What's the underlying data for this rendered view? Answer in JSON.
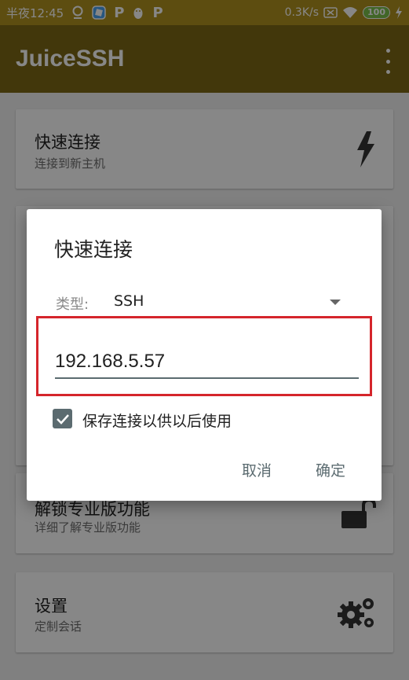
{
  "status_bar": {
    "time": "半夜12:45",
    "network_speed": "0.3K/s",
    "battery": "100"
  },
  "app_bar": {
    "title": "JuiceSSH"
  },
  "cards": [
    {
      "title": "快速连接",
      "subtitle": "连接到新主机",
      "icon": "lightning-icon"
    },
    {
      "title": "解锁专业版功能",
      "subtitle": "详细了解专业版功能",
      "icon": "unlock-icon"
    },
    {
      "title": "设置",
      "subtitle": "定制会话",
      "icon": "gears-icon"
    }
  ],
  "dialog": {
    "title": "快速连接",
    "type_label": "类型:",
    "type_value": "SSH",
    "host_value": "192.168.5.57",
    "save_checkbox_label": "保存连接以供以后使用",
    "save_checked": true,
    "cancel_label": "取消",
    "confirm_label": "确定"
  },
  "colors": {
    "app_bar": "#7e6815",
    "status_bar": "#b0911f",
    "accent": "#5b6b70",
    "highlight": "#d5252b"
  }
}
